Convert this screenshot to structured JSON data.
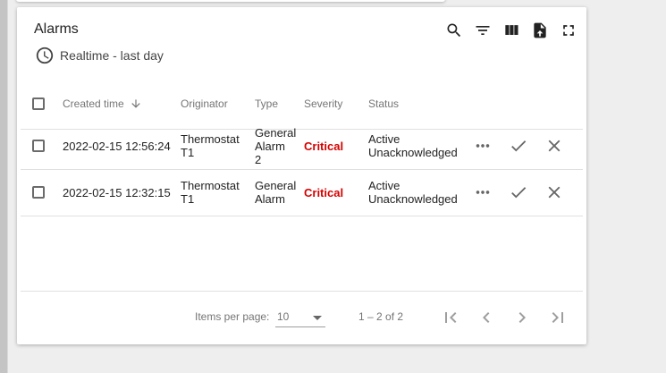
{
  "widget": {
    "title": "Alarms",
    "time_window": "Realtime - last day",
    "toolbar": [
      {
        "name": "search-icon"
      },
      {
        "name": "filter-icon"
      },
      {
        "name": "columns-icon"
      },
      {
        "name": "export-icon"
      },
      {
        "name": "fullscreen-icon"
      }
    ]
  },
  "table": {
    "columns": [
      "Created time",
      "Originator",
      "Type",
      "Severity",
      "Status"
    ],
    "sort": {
      "column": "Created time",
      "direction": "descending"
    },
    "rows": [
      {
        "created": "2022-02-15 12:56:24",
        "originator": [
          "Thermostat",
          "T1"
        ],
        "type": [
          "General",
          "Alarm",
          "2"
        ],
        "severity": "Critical",
        "status": [
          "Active",
          "Unacknowledged"
        ]
      },
      {
        "created": "2022-02-15 12:32:15",
        "originator": [
          "Thermostat",
          "T1"
        ],
        "type": [
          "General",
          "Alarm"
        ],
        "severity": "Critical",
        "status": [
          "Active",
          "Unacknowledged"
        ]
      }
    ]
  },
  "paginator": {
    "items_per_page_label": "Items per page:",
    "items_per_page": "10",
    "range_label": "1 – 2 of 2"
  },
  "colors": {
    "critical": "#d50000",
    "text": "#222222",
    "muted": "#757575"
  }
}
